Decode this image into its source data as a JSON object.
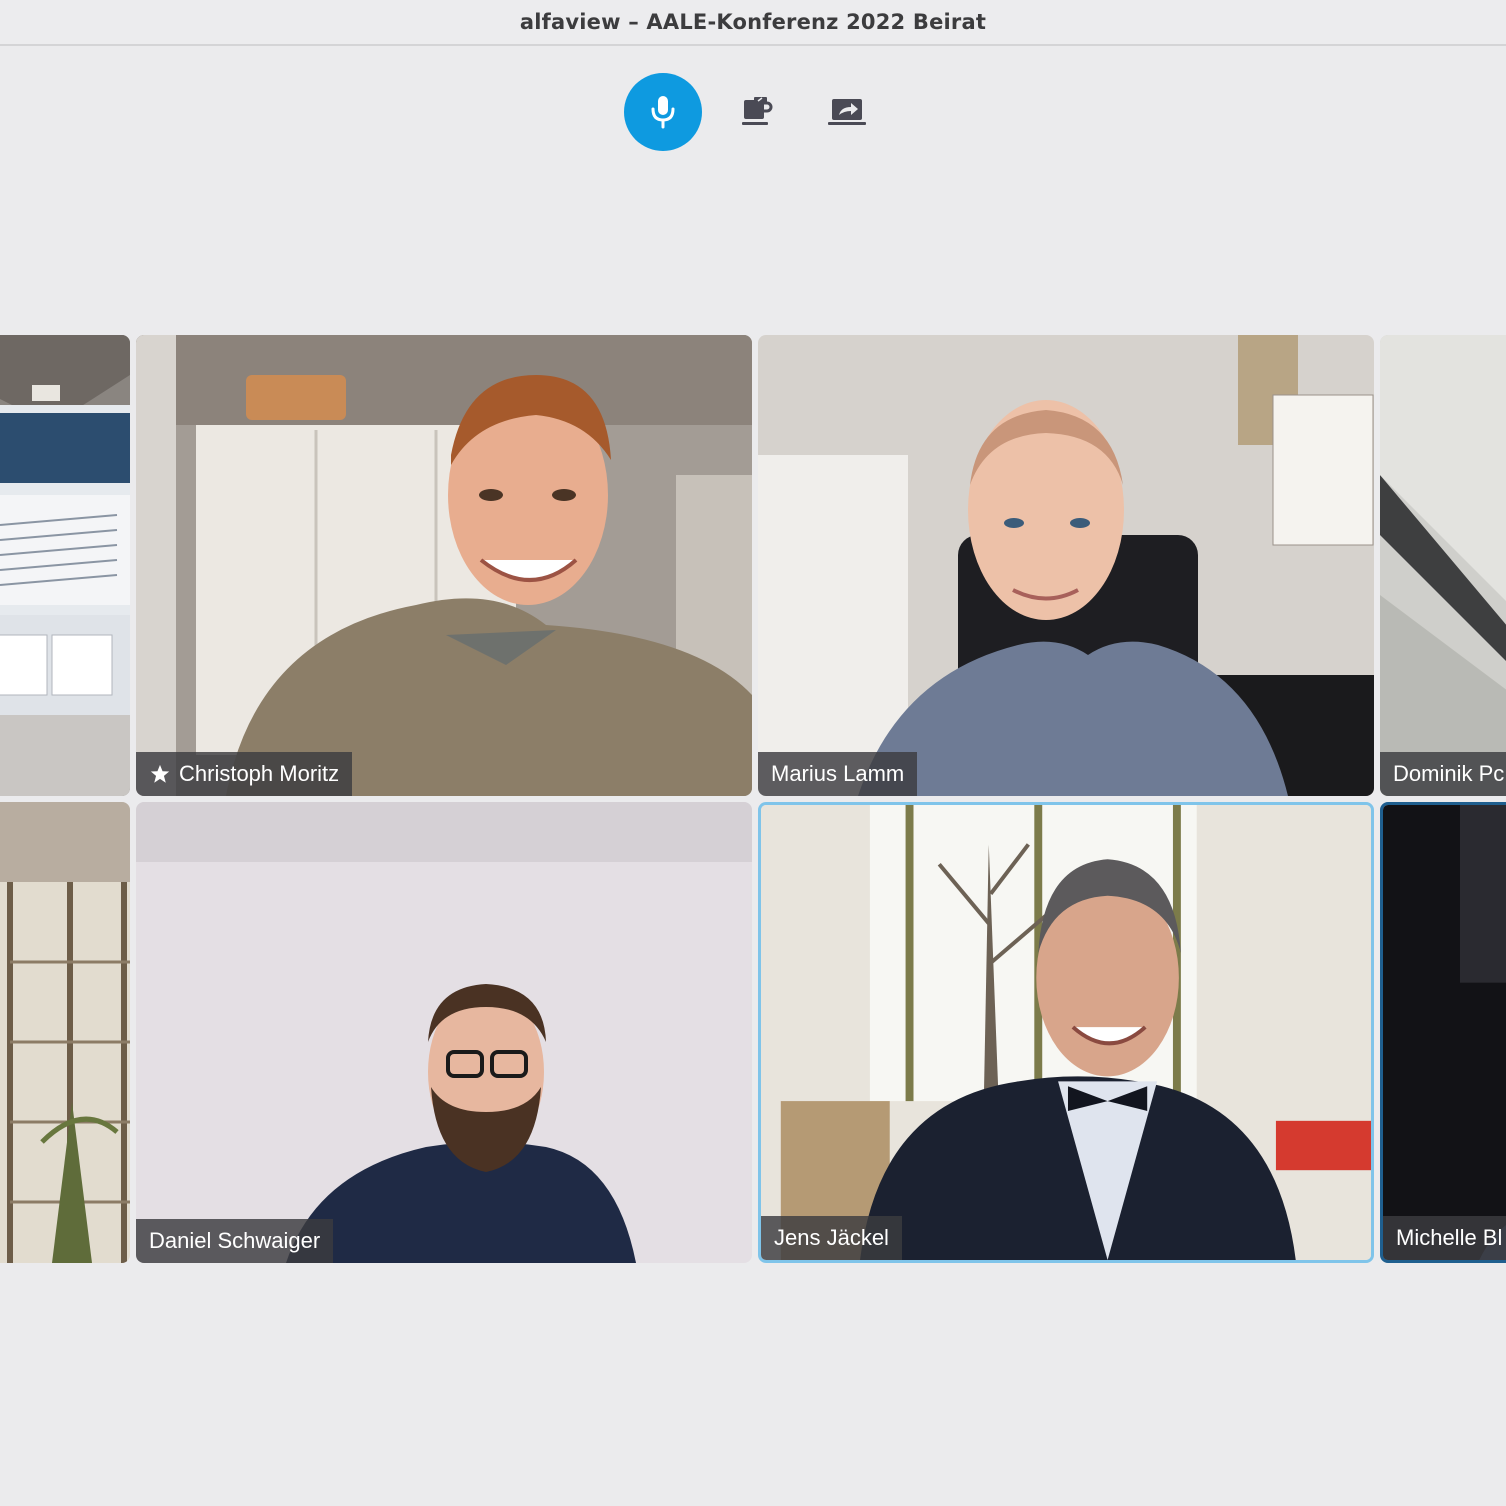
{
  "window": {
    "title": "alfaview – AALE-Konferenz 2022 Beirat"
  },
  "toolbar": {
    "mic": {
      "icon": "microphone-icon",
      "state": "active",
      "color": "#0e9ae0"
    },
    "coffee": {
      "icon": "coffee-cup-icon"
    },
    "share": {
      "icon": "screen-share-icon"
    }
  },
  "participants": [
    {
      "name": "",
      "icon": "",
      "note": "partially visible, no name shown"
    },
    {
      "name": "Christoph Moritz",
      "icon": "star-icon",
      "role": "moderator"
    },
    {
      "name": "Marius Lamm"
    },
    {
      "name": "Dominik Pc"
    },
    {
      "name": ""
    },
    {
      "name": "Daniel Schwaiger"
    },
    {
      "name": "Jens Jäckel",
      "speaking": true
    },
    {
      "name": "Michelle Bl"
    }
  ],
  "colors": {
    "accent": "#0e9ae0",
    "speaking_border": "#7fc4ea",
    "background": "#ebebed"
  }
}
